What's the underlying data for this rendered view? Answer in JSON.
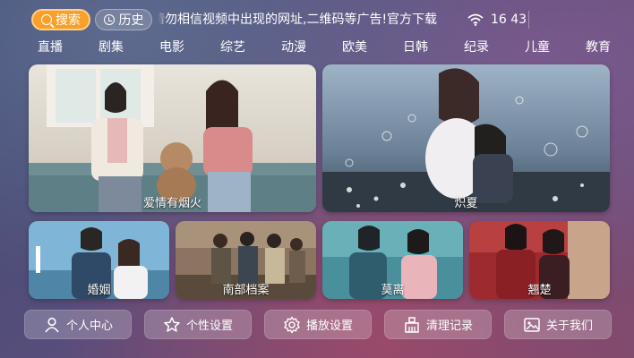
{
  "topbar": {
    "search_label": "搜索",
    "history_label": "历史",
    "marquee_text": "请勿相信视频中出现的网址,二维码等广告!官方下载",
    "time": "16 43"
  },
  "nav": {
    "items": [
      "直播",
      "剧集",
      "电影",
      "综艺",
      "动漫",
      "欧美",
      "日韩",
      "纪录",
      "儿童",
      "教育"
    ]
  },
  "cards": {
    "featured": [
      {
        "title": "爱情有烟火"
      },
      {
        "title": "炽夏"
      }
    ],
    "small": [
      {
        "title": "婚姻"
      },
      {
        "title": "南部档案"
      },
      {
        "title": "莫离"
      },
      {
        "title": "翘楚"
      }
    ]
  },
  "menu": {
    "profile_label": "个人中心",
    "settings_label": "个性设置",
    "playback_label": "播放设置",
    "clear_label": "清理记录",
    "about_label": "关于我们"
  },
  "icons": {
    "search": "search-icon",
    "history": "clock-icon",
    "wifi": "wifi-icon",
    "profile": "user-icon",
    "settings": "star-icon",
    "playback": "gear-icon",
    "clear": "broom-icon",
    "about": "image-info-icon"
  },
  "colors": {
    "accent": "#f9a02a"
  }
}
